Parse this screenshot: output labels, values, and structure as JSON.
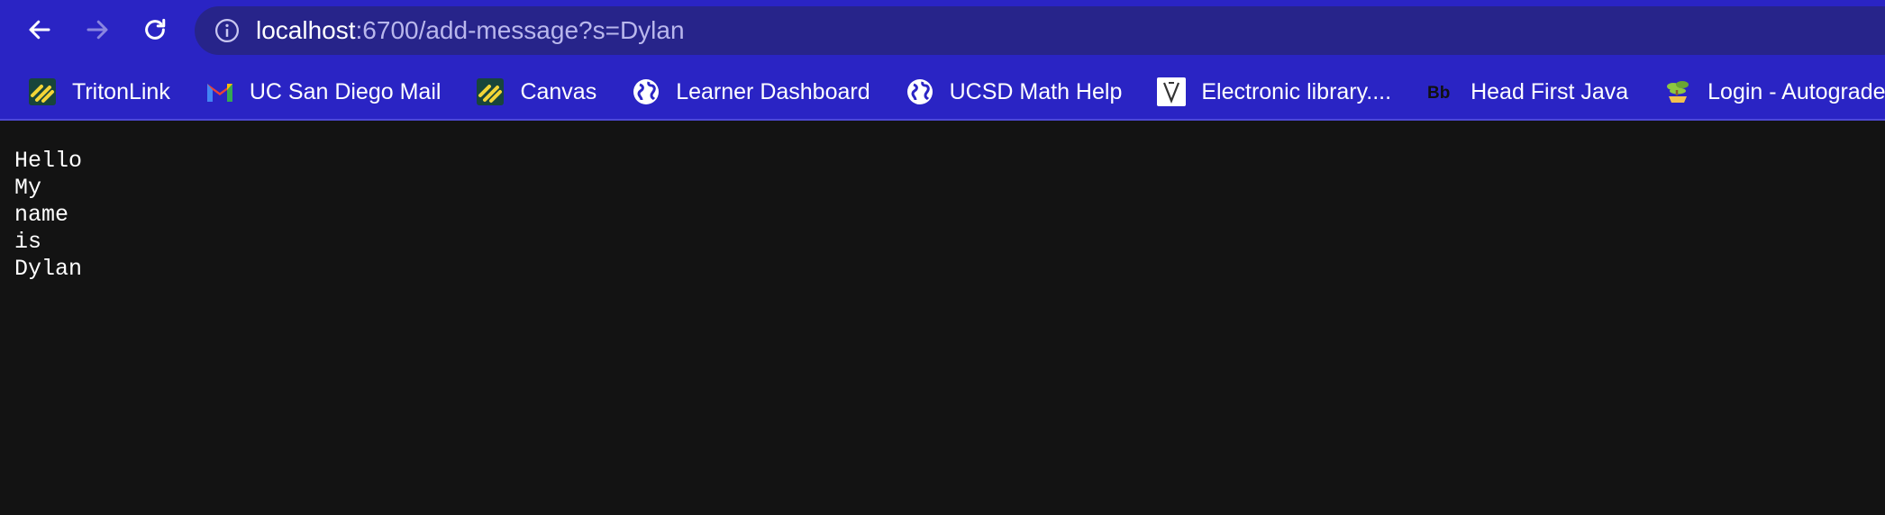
{
  "toolbar": {
    "url_host": "localhost",
    "url_rest": ":6700/add-message?s=Dylan"
  },
  "bookmarks": [
    {
      "label": "TritonLink",
      "icon": "tritonlink-icon"
    },
    {
      "label": "UC San Diego Mail",
      "icon": "gmail-icon"
    },
    {
      "label": "Canvas",
      "icon": "canvas-icon"
    },
    {
      "label": "Learner Dashboard",
      "icon": "globe-icon"
    },
    {
      "label": "UCSD Math Help",
      "icon": "globe-icon"
    },
    {
      "label": "Electronic library....",
      "icon": "v-logo-icon"
    },
    {
      "label": "Head First Java",
      "icon": "bb-icon"
    },
    {
      "label": "Login - Autograder",
      "icon": "bonsai-icon"
    }
  ],
  "page": {
    "lines": [
      "Hello",
      "My",
      "name",
      "is",
      "Dylan"
    ]
  },
  "colors": {
    "chrome": "#2a24c4",
    "omnibox": "#27248a",
    "page_background": "#131313",
    "text": "#ffffff"
  }
}
